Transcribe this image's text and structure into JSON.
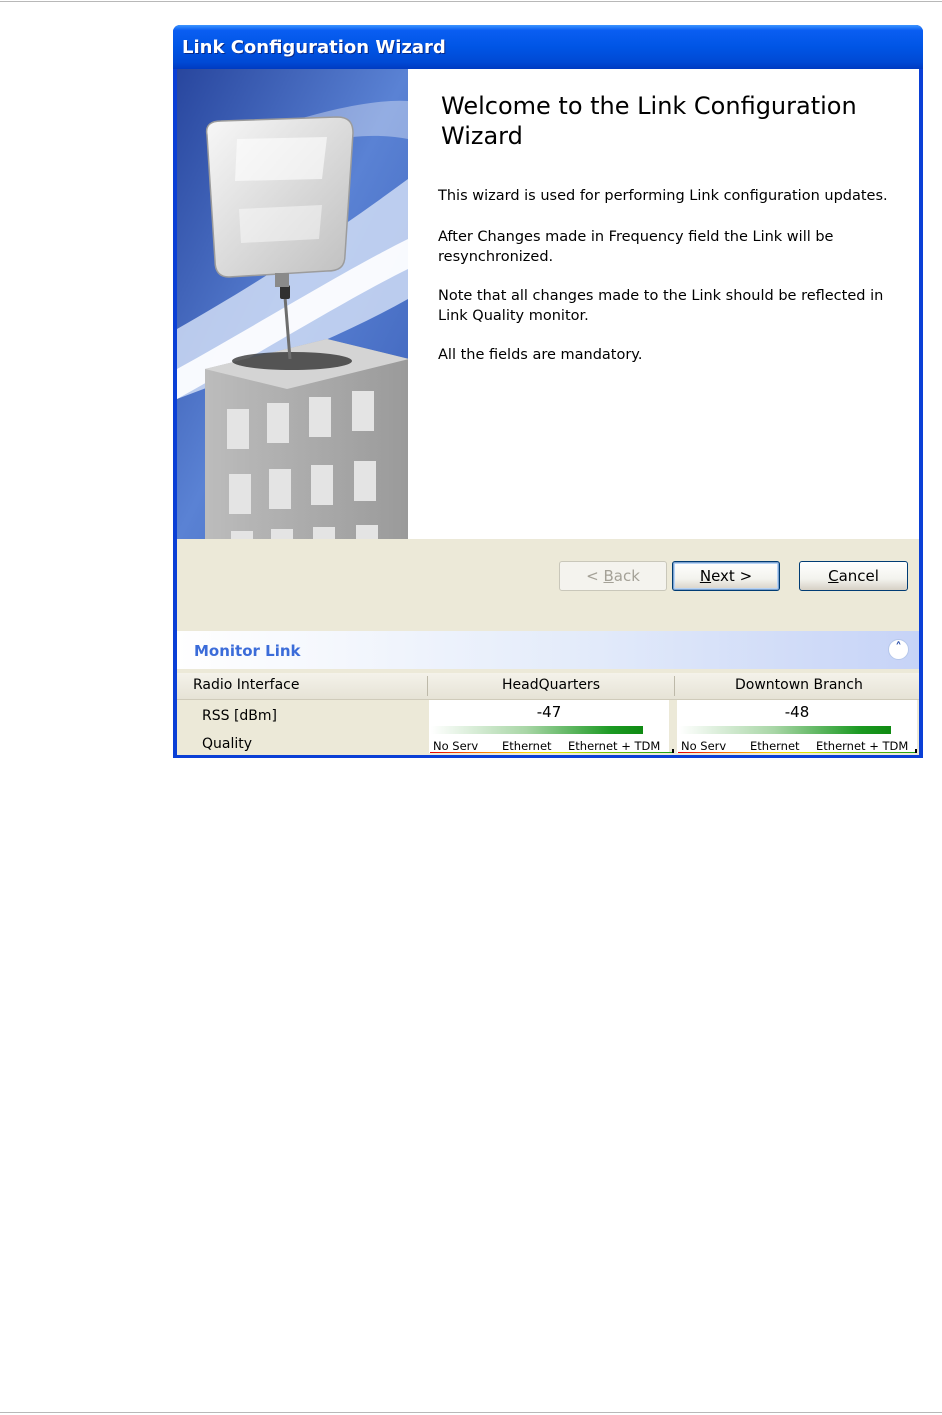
{
  "window": {
    "title": "Link Configuration Wizard"
  },
  "welcome": {
    "heading": "Welcome to the Link Configuration Wizard",
    "paragraphs": [
      "This wizard is used for performing Link configuration updates.",
      "After Changes made in Frequency field the Link will be resynchronized.",
      "Note that all changes made to the Link should be reflected in Link Quality monitor.",
      "All the fields are mandatory."
    ]
  },
  "buttons": {
    "back_prefix": "< ",
    "back_key": "B",
    "back_rest": "ack",
    "next_key": "N",
    "next_rest": "ext >",
    "cancel_key": "C",
    "cancel_rest": "ancel"
  },
  "monitor": {
    "title": "Monitor Link",
    "collapse_icon": "double-chevron-up-icon",
    "columns": [
      "Radio Interface",
      "HeadQuarters",
      "Downtown Branch"
    ],
    "rows": [
      "RSS [dBm]",
      "Quality"
    ],
    "headquarters": {
      "rss": "-47"
    },
    "downtown": {
      "rss": "-48"
    },
    "quality_labels": [
      "No Serv",
      "Ethernet",
      "Ethernet + TDM"
    ]
  },
  "colors": {
    "title_bar": "#0055e5",
    "monitor_title": "#3b6cd9"
  }
}
